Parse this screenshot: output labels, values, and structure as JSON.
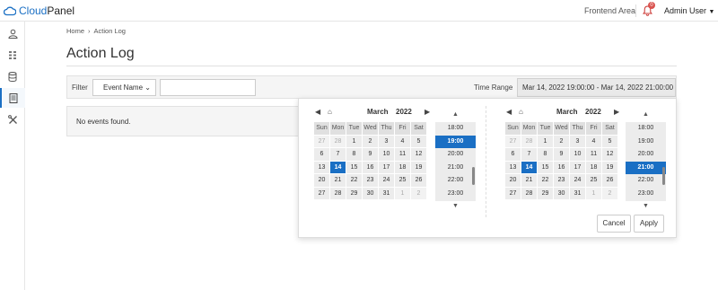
{
  "app": {
    "logo_text_a": "Cloud",
    "logo_text_b": "Panel"
  },
  "topbar": {
    "frontend_area": "Frontend Area",
    "notification_count": "0",
    "user": "Admin User"
  },
  "sidebar": {
    "items": [
      "user-icon",
      "grid-icon",
      "database-icon",
      "log-icon",
      "tools-icon"
    ],
    "active_index": 3
  },
  "breadcrumb": {
    "home": "Home",
    "current": "Action Log"
  },
  "page": {
    "title": "Action Log"
  },
  "filter": {
    "label": "Filter",
    "select_value": "Event Name",
    "input_value": "",
    "time_range_label": "Time Range",
    "time_range_value": "Mar 14, 2022 19:00:00 - Mar 14, 2022 21:00:00"
  },
  "results": {
    "empty_text": "No events found."
  },
  "datepicker": {
    "weekdays": [
      "Sun",
      "Mon",
      "Tue",
      "Wed",
      "Thu",
      "Fri",
      "Sat"
    ],
    "left": {
      "month": "March",
      "year": "2022",
      "selected_day": "14",
      "selected_time": "19:00"
    },
    "right": {
      "month": "March",
      "year": "2022",
      "selected_day": "14",
      "selected_time": "21:00"
    },
    "weeks": [
      [
        "27",
        "28",
        "1",
        "2",
        "3",
        "4",
        "5"
      ],
      [
        "6",
        "7",
        "8",
        "9",
        "10",
        "11",
        "12"
      ],
      [
        "13",
        "14",
        "15",
        "16",
        "17",
        "18",
        "19"
      ],
      [
        "20",
        "21",
        "22",
        "23",
        "24",
        "25",
        "26"
      ],
      [
        "27",
        "28",
        "29",
        "30",
        "31",
        "1",
        "2"
      ]
    ],
    "times": [
      "18:00",
      "19:00",
      "20:00",
      "21:00",
      "22:00",
      "23:00"
    ],
    "cancel_label": "Cancel",
    "apply_label": "Apply",
    "accent_color": "#1a6fc4"
  }
}
